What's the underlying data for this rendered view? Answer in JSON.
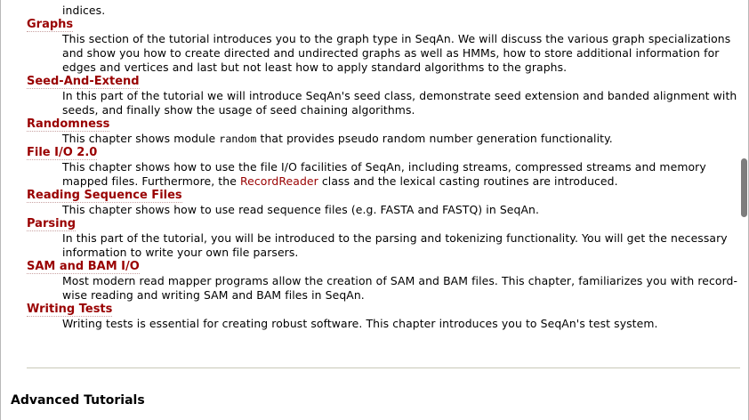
{
  "top_fragment": "indices.",
  "items": [
    {
      "title": "Graphs",
      "desc": "This section of the tutorial introduces you to the graph type in SeqAn. We will discuss the various graph specializations and show you how to create directed and undirected graphs as well as HMMs, how to store additional information for edges and vertices and last but not least how to apply standard algorithms to the graphs."
    },
    {
      "title": "Seed-And-Extend",
      "desc": "In this part of the tutorial we will introduce SeqAn's seed class, demonstrate seed extension and banded alignment with seeds, and finally show the usage of seed chaining algorithms."
    },
    {
      "title": "Randomness",
      "desc_before": "This chapter shows module ",
      "desc_code": "random",
      "desc_after": " that provides pseudo random number generation functionality."
    },
    {
      "title": "File I/O 2.0",
      "desc_before": "This chapter shows how to use the file I/O facilities of SeqAn, including streams, compressed streams and memory mapped files. Furthermore, the ",
      "desc_link": "RecordReader",
      "desc_after": " class and the lexical casting routines are introduced."
    },
    {
      "title": "Reading Sequence Files",
      "desc": "This chapter shows how to use read sequence files (e.g. FASTA and FASTQ) in SeqAn."
    },
    {
      "title": "Parsing",
      "desc": "In this part of the tutorial, you will be introduced to the parsing and tokenizing functionality. You will get the necessary information to write your own file parsers."
    },
    {
      "title": "SAM and BAM I/O",
      "desc": "Most modern read mapper programs allow the creation of SAM and BAM files. This chapter, familiarizes you with record-wise reading and writing SAM and BAM files in SeqAn."
    },
    {
      "title": "Writing Tests",
      "desc": "Writing tests is essential for creating robust software. This chapter introduces you to SeqAn's test system."
    }
  ],
  "section_heading": "Advanced Tutorials",
  "colors": {
    "link": "#990000",
    "text": "#000000",
    "rule": "#c9c9b8",
    "scrollbar": "#7d7d7d"
  }
}
